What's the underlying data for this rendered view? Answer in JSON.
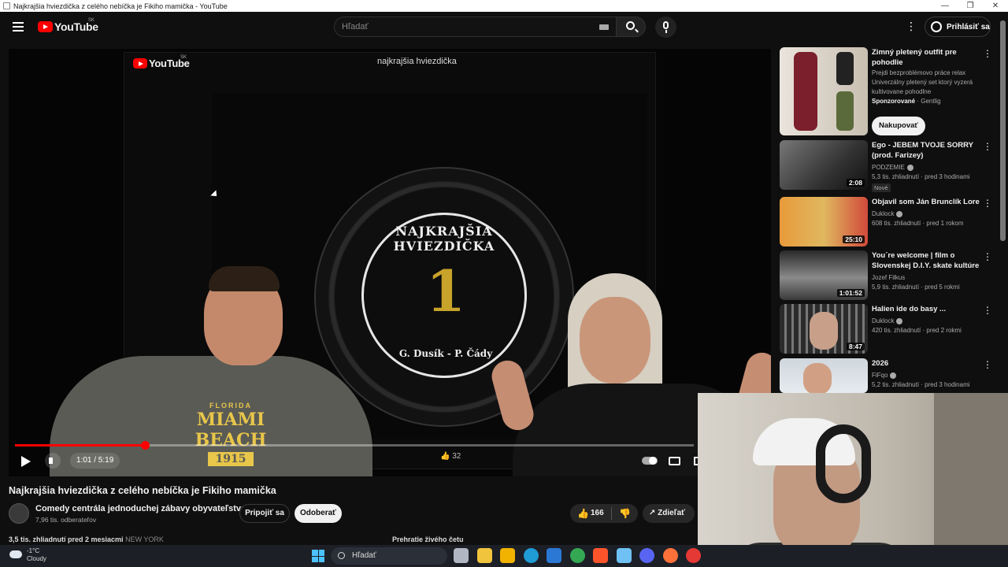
{
  "window": {
    "title": "Najkrajšia hviezdička z celého nebíčka je Fikiho mamička - YouTube",
    "controls": [
      "—",
      "❐",
      "✕"
    ]
  },
  "masthead": {
    "logo_text": "YouTube",
    "region": "SK",
    "search_placeholder": "Hľadať",
    "signin_label": "Prihlásiť sa"
  },
  "player": {
    "overlay_logo": "YouTube",
    "overlay_region": "SK",
    "overlay_title": "najkrajšia hviezdička",
    "disc_top_text": "NAJKRAJŠIA HVIEZDIČKA",
    "disc_number": "1",
    "disc_bottom_text": "G. Dusík - P. Čády",
    "shirt_line1": "FLORIDA",
    "shirt_line2": "MIAMI BEACH",
    "shirt_line3": "1915",
    "time_display": "1:01 / 5:19",
    "progress_fraction": 0.191,
    "overlay_like_count": "32"
  },
  "video": {
    "title": "Najkrajšia hviezdička z celého nebíčka je Fikiho mamička",
    "channel_name": "Comedy centrála jednoduchej zábavy obyvateľstva",
    "subscribers": "7,96 tis. odberateľov",
    "join_label": "Pripojiť sa",
    "subscribe_label": "Odoberať",
    "like_count": "166",
    "share_label": "Zdieľať",
    "desc_views": "3,5 tis. zhliadnutí  pred 2 mesiacmi",
    "desc_place": "NEW YORK",
    "chat_replay": "Prehratie živého četu"
  },
  "sidebar": {
    "sponsored": {
      "title": "Zimný pletený outfit pre pohodlie",
      "desc_line1": "Prejdi bezproblémovo práce relax",
      "desc_line2": "Univerzálny pletený set ktorý vyzerá kultivovane pohodlne",
      "sponsored_label": "Sponzorované",
      "advertiser": "Gentlig",
      "shop_label": "Nakupovať"
    },
    "items": [
      {
        "title": "Ego - JEBEM TVOJE SORRY (prod. Farizey)",
        "channel": "PODZEMIE",
        "meta": "5,3 tis. zhliadnutí · pred 3 hodinami",
        "badge": "Nové",
        "duration": "2:08"
      },
      {
        "title": "Objavil som Ján Brunclík Lore",
        "channel": "Duklock",
        "meta": "608 tis. zhliadnutí · pred 1 rokom",
        "badge": "",
        "duration": "25:10"
      },
      {
        "title": "You´re welcome | film o Slovenskej D.I.Y. skate kultúre",
        "channel": "Jozef Filkus",
        "meta": "5,9 tis. zhliadnutí · pred 5 rokmi",
        "badge": "",
        "duration": "1:01:52"
      },
      {
        "title": "Halien ide do basy ...",
        "channel": "Duklock",
        "meta": "420 tis. zhliadnutí · pred 2 rokmi",
        "badge": "",
        "duration": "8:47"
      },
      {
        "title": "2026",
        "channel": "FiFqo",
        "meta": "5,2 tis. zhliadnutí · pred 3 hodinami",
        "badge": "",
        "duration": ""
      }
    ]
  },
  "taskbar": {
    "temperature": "-1°C",
    "weather": "Cloudy",
    "search_label": "Hľadať"
  },
  "colors": {
    "accent": "#ff0000",
    "background": "#0f0f0f",
    "taskbar": "#1c1f26"
  }
}
